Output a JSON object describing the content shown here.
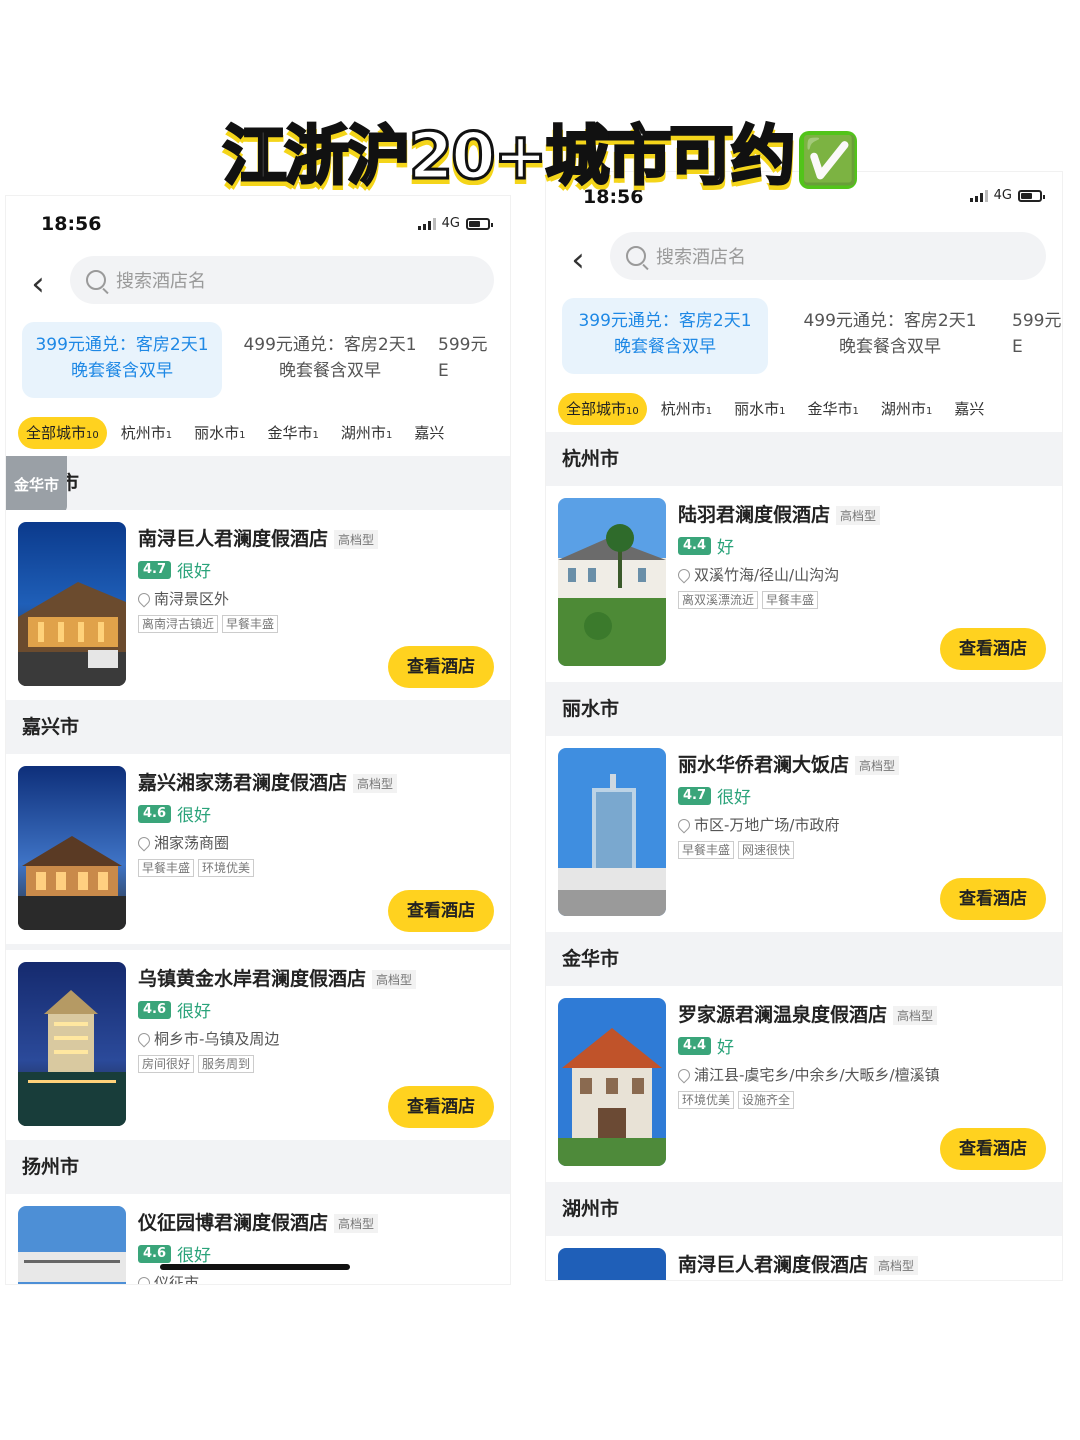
{
  "headline": {
    "text": "江浙沪20+城市可约",
    "badge": "✅"
  },
  "left": {
    "status": {
      "time": "18:56",
      "network": "4G"
    },
    "search_placeholder": "搜索酒店名",
    "packages": [
      {
        "line1": "399元通兑：客房2天1",
        "line2": "晚套餐含双早"
      },
      {
        "line1": "499元通兑：客房2天1",
        "line2": "晚套餐含双早"
      },
      {
        "line1": "599元",
        "line2": "E"
      }
    ],
    "chips": [
      {
        "label": "全部城市",
        "count": "10"
      },
      {
        "label": "杭州市",
        "count": "1"
      },
      {
        "label": "丽水市",
        "count": "1"
      },
      {
        "label": "金华市",
        "count": "1"
      },
      {
        "label": "湖州市",
        "count": "1"
      },
      {
        "label": "嘉兴",
        "count": ""
      }
    ],
    "floating_city": "金华市",
    "sections": [
      {
        "city": "湖州市",
        "hotels": [
          {
            "name": "南浔巨人君澜度假酒店",
            "tier": "高档型",
            "score": "4.7",
            "rating": "很好",
            "location": "南浔景区外",
            "tags": [
              "离南浔古镇近",
              "早餐丰盛"
            ],
            "button": "查看酒店"
          }
        ]
      },
      {
        "city": "嘉兴市",
        "hotels": [
          {
            "name": "嘉兴湘家荡君澜度假酒店",
            "tier": "高档型",
            "score": "4.6",
            "rating": "很好",
            "location": "湘家荡商圈",
            "tags": [
              "早餐丰盛",
              "环境优美"
            ],
            "button": "查看酒店"
          },
          {
            "name": "乌镇黄金水岸君澜度假酒店",
            "tier": "高档型",
            "score": "4.6",
            "rating": "很好",
            "location": "桐乡市-乌镇及周边",
            "tags": [
              "房间很好",
              "服务周到"
            ],
            "button": "查看酒店"
          }
        ]
      },
      {
        "city": "扬州市",
        "hotels": [
          {
            "name": "仪征园博君澜度假酒店",
            "tier": "高档型",
            "score": "4.6",
            "rating": "很好",
            "location": "仪征市",
            "tags": [],
            "button": ""
          }
        ]
      }
    ]
  },
  "right": {
    "status": {
      "time": "18:56",
      "network": "4G"
    },
    "search_placeholder": "搜索酒店名",
    "packages": [
      {
        "line1": "399元通兑：客房2天1",
        "line2": "晚套餐含双早"
      },
      {
        "line1": "499元通兑：客房2天1",
        "line2": "晚套餐含双早"
      },
      {
        "line1": "599元",
        "line2": "E"
      }
    ],
    "chips": [
      {
        "label": "全部城市",
        "count": "10"
      },
      {
        "label": "杭州市",
        "count": "1"
      },
      {
        "label": "丽水市",
        "count": "1"
      },
      {
        "label": "金华市",
        "count": "1"
      },
      {
        "label": "湖州市",
        "count": "1"
      },
      {
        "label": "嘉兴",
        "count": ""
      }
    ],
    "sections": [
      {
        "city": "杭州市",
        "hotels": [
          {
            "name": "陆羽君澜度假酒店",
            "tier": "高档型",
            "score": "4.4",
            "rating": "好",
            "location": "双溪竹海/径山/山沟沟",
            "tags": [
              "离双溪漂流近",
              "早餐丰盛"
            ],
            "button": "查看酒店"
          }
        ]
      },
      {
        "city": "丽水市",
        "hotels": [
          {
            "name": "丽水华侨君澜大饭店",
            "tier": "高档型",
            "score": "4.7",
            "rating": "很好",
            "location": "市区-万地广场/市政府",
            "tags": [
              "早餐丰盛",
              "网速很快"
            ],
            "button": "查看酒店"
          }
        ]
      },
      {
        "city": "金华市",
        "hotels": [
          {
            "name": "罗家源君澜温泉度假酒店",
            "tier": "高档型",
            "score": "4.4",
            "rating": "好",
            "location": "浦江县-虞宅乡/中余乡/大畈乡/檀溪镇",
            "tags": [
              "环境优美",
              "设施齐全"
            ],
            "button": "查看酒店"
          }
        ]
      },
      {
        "city": "湖州市",
        "hotels": [
          {
            "name": "南浔巨人君澜度假酒店",
            "tier": "高档型",
            "score": "",
            "rating": "",
            "location": "",
            "tags": [],
            "button": ""
          }
        ]
      }
    ]
  }
}
